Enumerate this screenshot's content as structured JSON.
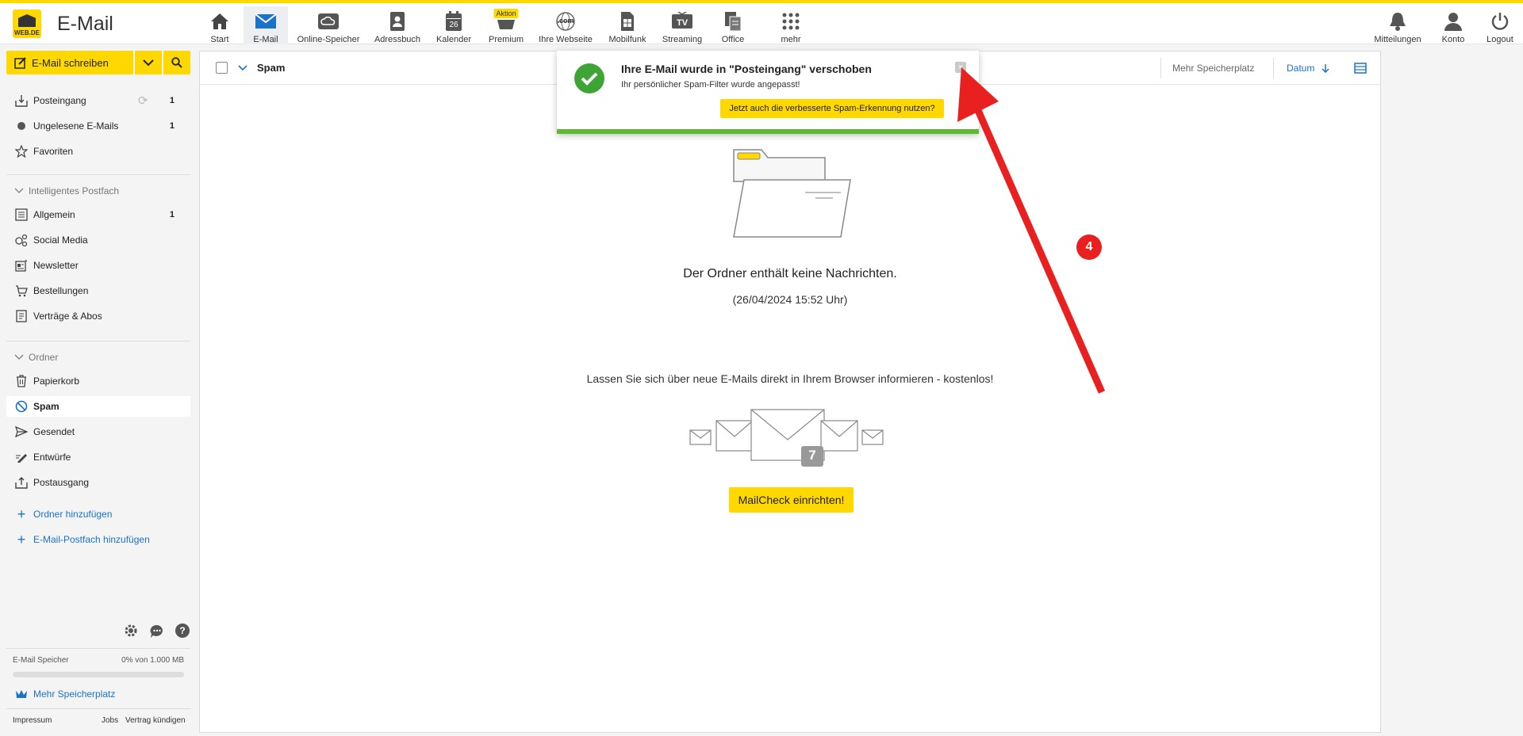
{
  "app": {
    "title": "E-Mail",
    "logo_text": "WEB.DE"
  },
  "nav": {
    "items": [
      {
        "label": "Start",
        "icon": "home-icon"
      },
      {
        "label": "E-Mail",
        "icon": "mail-icon",
        "active": true
      },
      {
        "label": "Online-Speicher",
        "icon": "cloud-icon"
      },
      {
        "label": "Adressbuch",
        "icon": "address-book-icon"
      },
      {
        "label": "Kalender",
        "icon": "calendar-icon",
        "day": "26"
      },
      {
        "label": "Premium",
        "icon": "basket-icon",
        "badge": "Aktion"
      },
      {
        "label": "Ihre Webseite",
        "icon": "globe-icon",
        "icon_text": ".com"
      },
      {
        "label": "Mobilfunk",
        "icon": "sim-icon"
      },
      {
        "label": "Streaming",
        "icon": "tv-icon",
        "icon_text": "TV"
      },
      {
        "label": "Office",
        "icon": "office-icon"
      },
      {
        "label": "mehr",
        "icon": "grid-icon"
      }
    ],
    "right": [
      {
        "label": "Mitteilungen",
        "icon": "bell-icon"
      },
      {
        "label": "Konto",
        "icon": "user-icon"
      },
      {
        "label": "Logout",
        "icon": "power-icon"
      }
    ]
  },
  "sidebar": {
    "compose_label": "E-Mail schreiben",
    "top_items": [
      {
        "label": "Posteingang",
        "count": "1",
        "icon": "inbox-icon"
      },
      {
        "label": "Ungelesene E-Mails",
        "count": "1",
        "icon": "dot-icon"
      },
      {
        "label": "Favoriten",
        "count": "",
        "icon": "star-icon"
      }
    ],
    "smart_heading": "Intelligentes Postfach",
    "smart_items": [
      {
        "label": "Allgemein",
        "count": "1",
        "icon": "list-icon"
      },
      {
        "label": "Social Media",
        "count": "",
        "icon": "social-icon"
      },
      {
        "label": "Newsletter",
        "count": "",
        "icon": "newsletter-icon"
      },
      {
        "label": "Bestellungen",
        "count": "",
        "icon": "cart-icon"
      },
      {
        "label": "Verträge & Abos",
        "count": "",
        "icon": "contract-icon"
      }
    ],
    "folders_heading": "Ordner",
    "folder_items": [
      {
        "label": "Papierkorb",
        "icon": "trash-icon"
      },
      {
        "label": "Spam",
        "icon": "spam-icon",
        "selected": true
      },
      {
        "label": "Gesendet",
        "icon": "send-icon"
      },
      {
        "label": "Entwürfe",
        "icon": "pencil-icon"
      },
      {
        "label": "Postausgang",
        "icon": "outbox-icon"
      }
    ],
    "add_folder": "Ordner hinzufügen",
    "add_mailbox": "E-Mail-Postfach hinzufügen",
    "storage_label": "E-Mail Speicher",
    "storage_value": "0% von 1.000 MB",
    "storage_fraction": 0.0,
    "more_storage": "Mehr Speicherplatz",
    "footer": {
      "impressum": "Impressum",
      "jobs": "Jobs",
      "cancel": "Vertrag kündigen"
    }
  },
  "main": {
    "folder_name": "Spam",
    "more_storage": "Mehr Speicherplatz",
    "sort_label": "Datum",
    "empty_text": "Der Ordner enthält keine Nachrichten.",
    "timestamp": "(26/04/2024 15:52 Uhr)",
    "promo_text": "Lassen Sie sich über neue E-Mails direkt in Ihrem Browser informieren - kostenlos!",
    "promo_count": "7",
    "mailcheck_btn": "MailCheck einrichten!"
  },
  "toast": {
    "title": "Ihre E-Mail wurde in \"Posteingang\" verschoben",
    "subtitle": "Ihr persönlicher Spam-Filter wurde angepasst!",
    "button": "Jetzt auch die verbesserte Spam-Erkennung nutzen?",
    "close": "×"
  },
  "annotation": {
    "step": "4",
    "color": "#e82020"
  },
  "colors": {
    "brand": "#ffd800",
    "accent": "#1a73c8",
    "success": "#3ea435"
  }
}
